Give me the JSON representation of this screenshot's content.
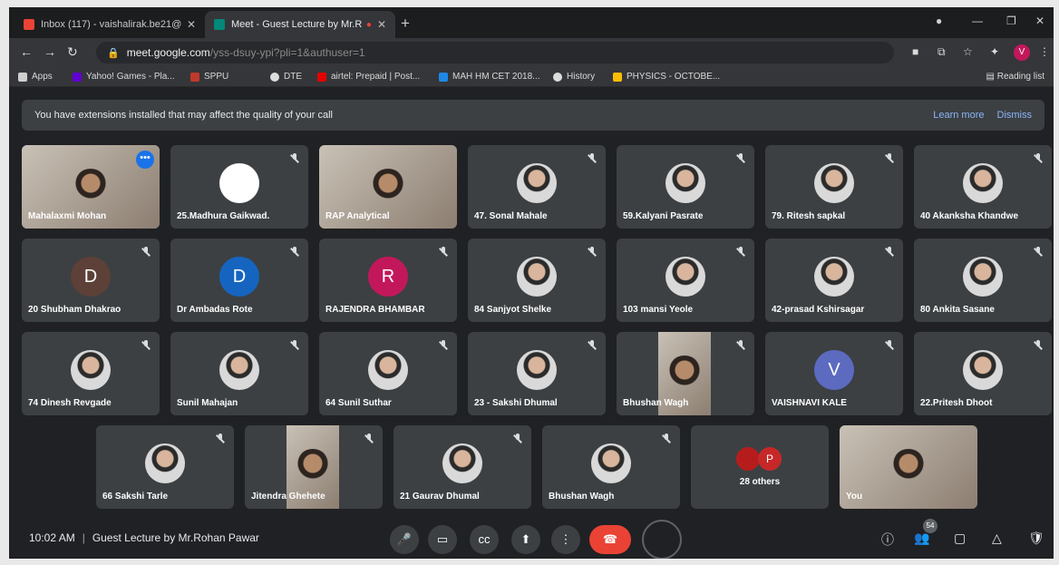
{
  "browser": {
    "tabs": [
      {
        "label": "Inbox (117) - vaishalirak.be21@",
        "icon": "gmail-icon",
        "active": false
      },
      {
        "label": "Meet - Guest Lecture by Mr.R",
        "icon": "meet-icon",
        "active": true
      }
    ],
    "url_host": "meet.google.com",
    "url_path": "/yss-dsuy-ypi?pli=1&authuser=1",
    "bookmarks": [
      {
        "label": "Apps",
        "icon": "apps-icon",
        "color": "#cfcfcf"
      },
      {
        "label": "Yahoo! Games - Pla...",
        "icon": "yahoo-icon",
        "color": "#6001d2"
      },
      {
        "label": "SPPU",
        "icon": "sppu-icon",
        "color": "#c0392b"
      },
      {
        "label": "DTE",
        "icon": "dte-icon",
        "color": "#dddddd"
      },
      {
        "label": "airtel: Prepaid | Post...",
        "icon": "airtel-icon",
        "color": "#e40000"
      },
      {
        "label": "MAH HM CET 2018...",
        "icon": "mah-icon",
        "color": "#1e88e5"
      },
      {
        "label": "History",
        "icon": "history-icon",
        "color": "#dddddd"
      },
      {
        "label": "PHYSICS - OCTOBE...",
        "icon": "doc-icon",
        "color": "#fbbc04"
      }
    ],
    "reading_list": "Reading list"
  },
  "banner": {
    "text": "You have extensions installed that may affect the quality of your call",
    "learn_more": "Learn more",
    "dismiss": "Dismiss"
  },
  "participants": [
    {
      "name": "Mahalaxmi Mohan",
      "kind": "video",
      "active": true
    },
    {
      "name": "25.Madhura Gaikwad.",
      "kind": "avatar",
      "letter": "",
      "color": "#ffffff"
    },
    {
      "name": "RAP Analytical",
      "kind": "video"
    },
    {
      "name": "47. Sonal Mahale",
      "kind": "photo"
    },
    {
      "name": "59.Kalyani Pasrate",
      "kind": "photo"
    },
    {
      "name": "79. Ritesh sapkal",
      "kind": "photo"
    },
    {
      "name": "40 Akanksha Khandwe",
      "kind": "photo"
    },
    {
      "name": "20 Shubham Dhakrao",
      "kind": "avatar",
      "letter": "D",
      "color": "#5d4037"
    },
    {
      "name": "Dr Ambadas Rote",
      "kind": "avatar",
      "letter": "D",
      "color": "#1565c0"
    },
    {
      "name": "RAJENDRA BHAMBAR",
      "kind": "avatar",
      "letter": "R",
      "color": "#c2185b"
    },
    {
      "name": "84 Sanjyot Shelke",
      "kind": "photo"
    },
    {
      "name": "103 mansi Yeole",
      "kind": "photo"
    },
    {
      "name": "42-prasad Kshirsagar",
      "kind": "photo"
    },
    {
      "name": "80 Ankita Sasane",
      "kind": "photo"
    },
    {
      "name": "74 Dinesh Revgade",
      "kind": "photo"
    },
    {
      "name": "Sunil Mahajan",
      "kind": "photo"
    },
    {
      "name": "64 Sunil Suthar",
      "kind": "photo"
    },
    {
      "name": "23 - Sakshi Dhumal",
      "kind": "photo"
    },
    {
      "name": "Bhushan Wagh",
      "kind": "video"
    },
    {
      "name": "VAISHNAVI KALE",
      "kind": "avatar",
      "letter": "V",
      "color": "#5c6bc0"
    },
    {
      "name": "22.Pritesh Dhoot",
      "kind": "photo"
    },
    {
      "name": "66 Sakshi Tarle",
      "kind": "photo"
    },
    {
      "name": "Jitendra Ghehete",
      "kind": "video"
    },
    {
      "name": "21 Gaurav Dhumal",
      "kind": "photo"
    },
    {
      "name": "Bhushan Wagh",
      "kind": "photo"
    },
    {
      "name": "28 others",
      "kind": "others",
      "letter": "P",
      "color": "#c62828"
    },
    {
      "name": "You",
      "kind": "video"
    }
  ],
  "footer": {
    "time": "10:02 AM",
    "separator": "|",
    "meeting_title": "Guest Lecture by Mr.Rohan Pawar",
    "participant_count": "54"
  }
}
